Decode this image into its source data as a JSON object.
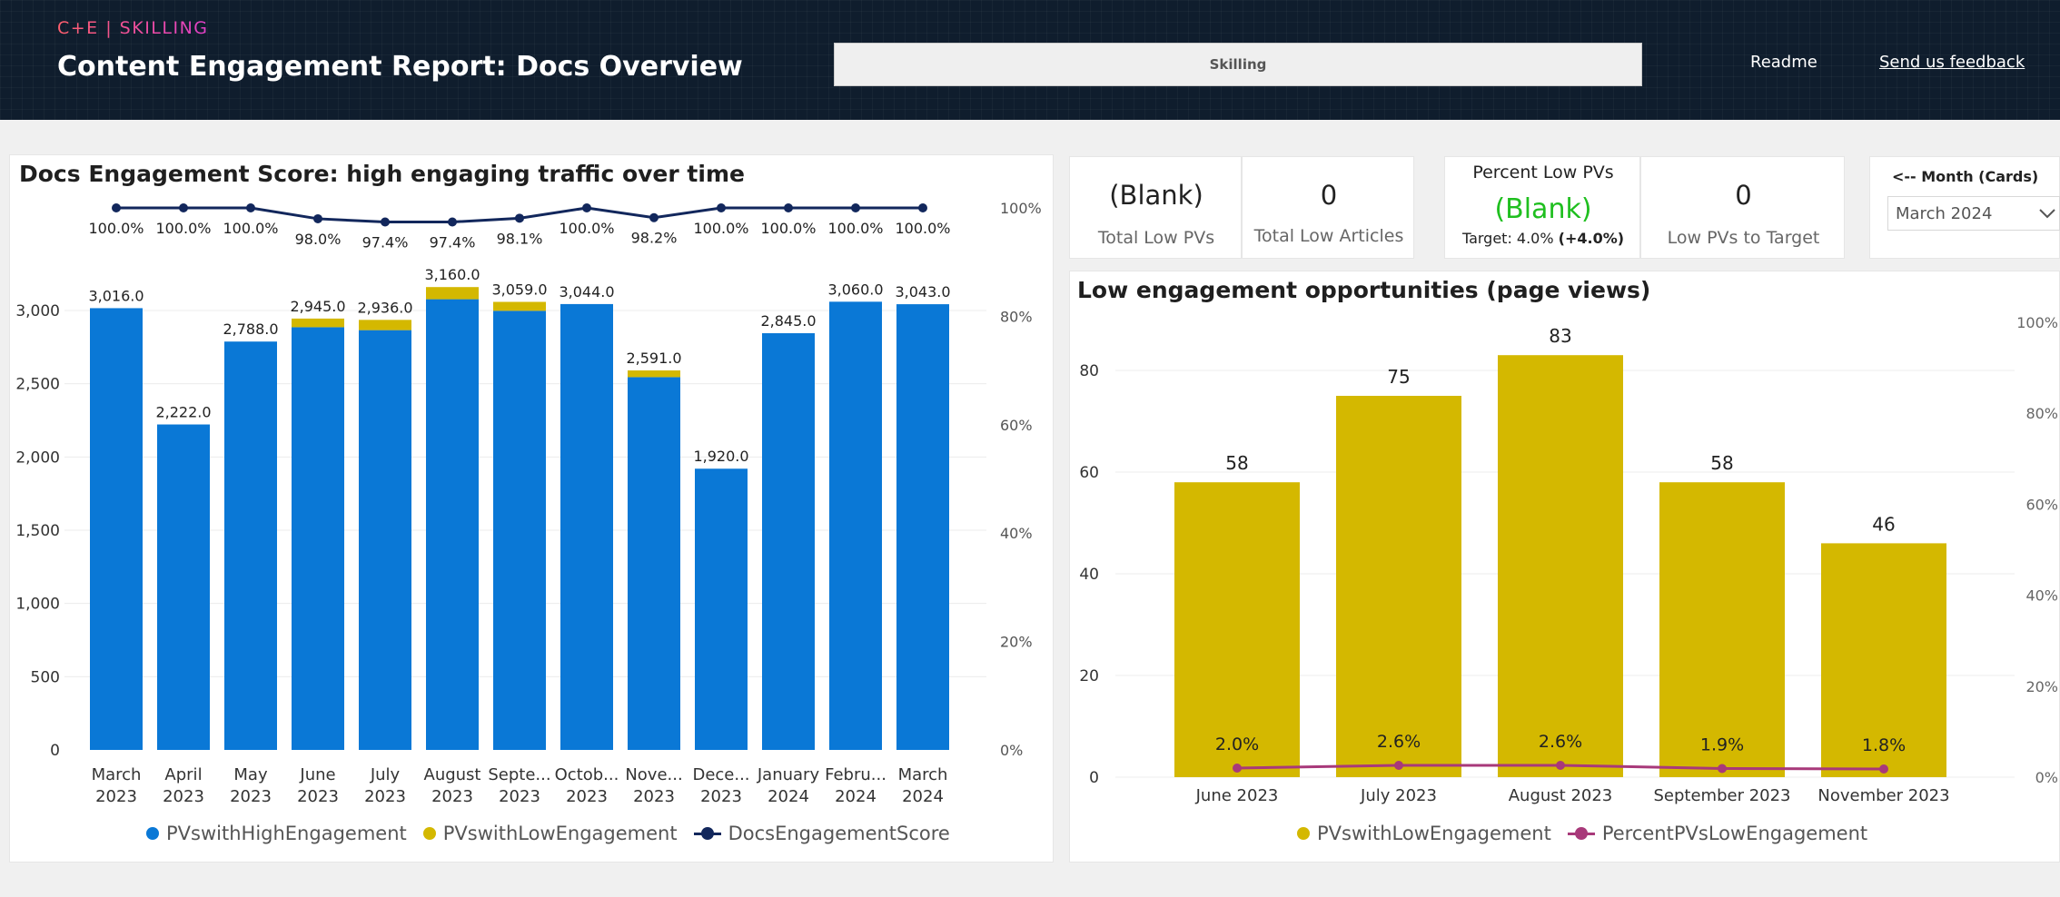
{
  "header": {
    "brand": "C+E | SKILLING",
    "title": "Content Engagement Report: Docs Overview",
    "tab_label": "Skilling",
    "readme": "Readme",
    "feedback": "Send us feedback"
  },
  "left_panel": {
    "title": "Docs Engagement Score: high engaging traffic over time",
    "legend": [
      "PVswithHighEngagement",
      "PVswithLowEngagement",
      "DocsEngagementScore"
    ]
  },
  "cards": {
    "total_low_pvs": {
      "value": "(Blank)",
      "label": "Total Low PVs"
    },
    "total_low_articles": {
      "value": "0",
      "label": "Total Low Articles"
    },
    "percent_low_pvs": {
      "title": "Percent Low PVs",
      "value": "(Blank)",
      "target_label": "Target: 4.0%",
      "target_delta": "(+4.0%)"
    },
    "low_pvs_to_target": {
      "value": "0",
      "label": "Low PVs to Target"
    },
    "month_filter": {
      "label": "<-- Month (Cards)",
      "selected": "March 2024"
    }
  },
  "right_panel": {
    "title": "Low engagement opportunities (page views)",
    "legend": [
      "PVswithLowEngagement",
      "PercentPVsLowEngagement"
    ]
  },
  "colors": {
    "high": "#0a78d6",
    "low": "#d4b800",
    "score": "#12275c",
    "percent": "#a8397a"
  },
  "chart_data": [
    {
      "type": "bar",
      "stacked": true,
      "title": "Docs Engagement Score: high engaging traffic over time",
      "categories": [
        [
          "March",
          "2023"
        ],
        [
          "April",
          "2023"
        ],
        [
          "May",
          "2023"
        ],
        [
          "June",
          "2023"
        ],
        [
          "July",
          "2023"
        ],
        [
          "August",
          "2023"
        ],
        [
          "Septe...",
          "2023"
        ],
        [
          "Octob...",
          "2023"
        ],
        [
          "Nove...",
          "2023"
        ],
        [
          "Dece...",
          "2023"
        ],
        [
          "January",
          "2024"
        ],
        [
          "Febru...",
          "2024"
        ],
        [
          "March",
          "2024"
        ]
      ],
      "series": [
        {
          "name": "PVswithHighEngagement",
          "values": [
            3016,
            2222,
            2788,
            2886,
            2866,
            3077,
            2998,
            3044,
            2545,
            1920,
            2845,
            3060,
            3043
          ]
        },
        {
          "name": "PVswithLowEngagement",
          "values": [
            0,
            0,
            0,
            59,
            70,
            83,
            61,
            0,
            46,
            0,
            0,
            0,
            0
          ]
        }
      ],
      "totals": [
        "3,016.0",
        "2,222.0",
        "2,788.0",
        "2,945.0",
        "2,936.0",
        "3,160.0",
        "3,059.0",
        "3,044.0",
        "2,591.0",
        "1,920.0",
        "2,845.0",
        "3,060.0",
        "3,043.0"
      ],
      "line": {
        "name": "DocsEngagementScore",
        "values": [
          100.0,
          100.0,
          100.0,
          98.0,
          97.4,
          97.4,
          98.1,
          100.0,
          98.2,
          100.0,
          100.0,
          100.0,
          100.0
        ],
        "labels": [
          "100.0%",
          "100.0%",
          "100.0%",
          "98.0%",
          "97.4%",
          "97.4%",
          "98.1%",
          "100.0%",
          "98.2%",
          "100.0%",
          "100.0%",
          "100.0%",
          "100.0%"
        ]
      },
      "y_ticks": [
        "0",
        "500",
        "1,000",
        "1,500",
        "2,000",
        "2,500",
        "3,000"
      ],
      "y2_ticks": [
        "0%",
        "20%",
        "40%",
        "60%",
        "80%",
        "100%"
      ],
      "ylim": [
        0,
        3350
      ],
      "y2lim": [
        0,
        100
      ],
      "legend_position": "bottom"
    },
    {
      "type": "bar",
      "title": "Low engagement opportunities (page views)",
      "categories": [
        "June 2023",
        "July 2023",
        "August 2023",
        "September 2023",
        "November 2023"
      ],
      "series": [
        {
          "name": "PVswithLowEngagement",
          "values": [
            58,
            75,
            83,
            58,
            46
          ]
        }
      ],
      "line": {
        "name": "PercentPVsLowEngagement",
        "values": [
          2.0,
          2.6,
          2.6,
          1.9,
          1.8
        ],
        "labels": [
          "2.0%",
          "2.6%",
          "2.6%",
          "1.9%",
          "1.8%"
        ]
      },
      "y_ticks": [
        "0",
        "20",
        "40",
        "60",
        "80"
      ],
      "y2_ticks": [
        "0%",
        "20%",
        "40%",
        "60%",
        "80%",
        "100%"
      ],
      "ylim": [
        0,
        92
      ],
      "y2lim": [
        0,
        100
      ],
      "legend_position": "bottom"
    }
  ]
}
